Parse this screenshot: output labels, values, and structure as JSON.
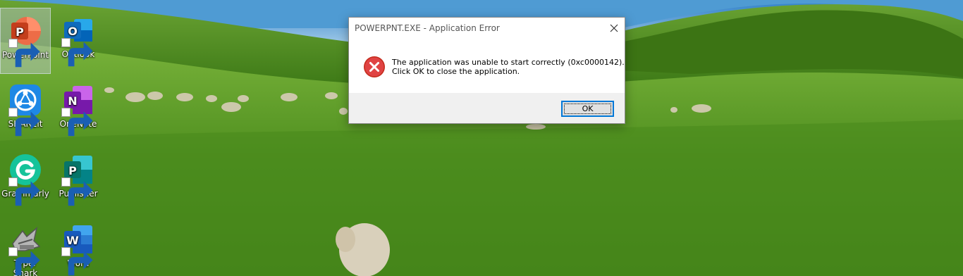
{
  "desktop": {
    "icons": [
      {
        "label": "PowerPoint",
        "icon": "powerpoint-icon",
        "color": "#d24726",
        "letter": "P",
        "selected": true
      },
      {
        "label": "Outlook",
        "icon": "outlook-icon",
        "color": "#0f6cbd",
        "letter": "O"
      },
      {
        "label": "SHAREit",
        "icon": "shareit-icon",
        "color": "#1e88e5",
        "letter": ""
      },
      {
        "label": "OneNote",
        "icon": "onenote-icon",
        "color": "#7719aa",
        "letter": "N"
      },
      {
        "label": "Grammarly",
        "icon": "grammarly-icon",
        "color": "#15c39a",
        "letter": "G"
      },
      {
        "label": "Publisher",
        "icon": "publisher-icon",
        "color": "#077568",
        "letter": "P"
      },
      {
        "label": "Typer Shark Deluxe",
        "icon": "typer-shark-icon",
        "color": "#8a8a8a",
        "letter": ""
      },
      {
        "label": "Word",
        "icon": "word-icon",
        "color": "#185abd",
        "letter": "W"
      }
    ]
  },
  "dialog": {
    "title": "POWERPNT.EXE - Application Error",
    "message_line1": "The application was unable to start correctly (0xc0000142).",
    "message_line2": "Click OK to close the application.",
    "ok_label": "OK",
    "error_color": "#e81123"
  }
}
